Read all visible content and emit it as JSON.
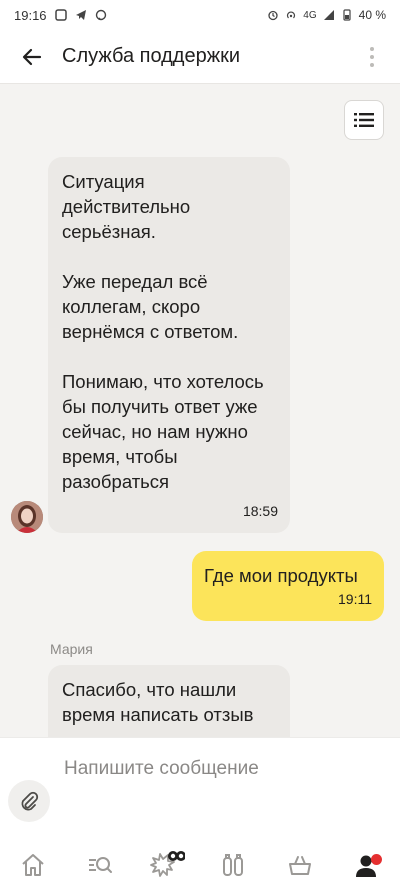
{
  "status_bar": {
    "time": "19:16",
    "network": "4G",
    "battery": "40 %"
  },
  "header": {
    "title": "Служба поддержки"
  },
  "messages": [
    {
      "direction": "incoming",
      "text": "Ситуация действительно серьёзная.\n\nУже передал всё коллегам, скоро вернёмся с ответом.\n\nПонимаю, что хотелось бы получить ответ уже сейчас, но нам нужно время, чтобы разобраться",
      "time": "18:59"
    },
    {
      "direction": "outgoing",
      "text": "Где мои продукты",
      "time": "19:11"
    },
    {
      "direction": "incoming",
      "sender": "Мария",
      "text": "Спасибо, что нашли время написать отзыв"
    }
  ],
  "composer": {
    "placeholder": "Напишите сообщение"
  },
  "colors": {
    "outgoing_bubble": "#fce45a",
    "incoming_bubble": "#ebe9e6",
    "notification_dot": "#e52f30"
  },
  "icons": {
    "nav": [
      "home-icon",
      "search-icon",
      "promo-icon",
      "favorites-icon",
      "cart-icon",
      "profile-icon"
    ]
  }
}
